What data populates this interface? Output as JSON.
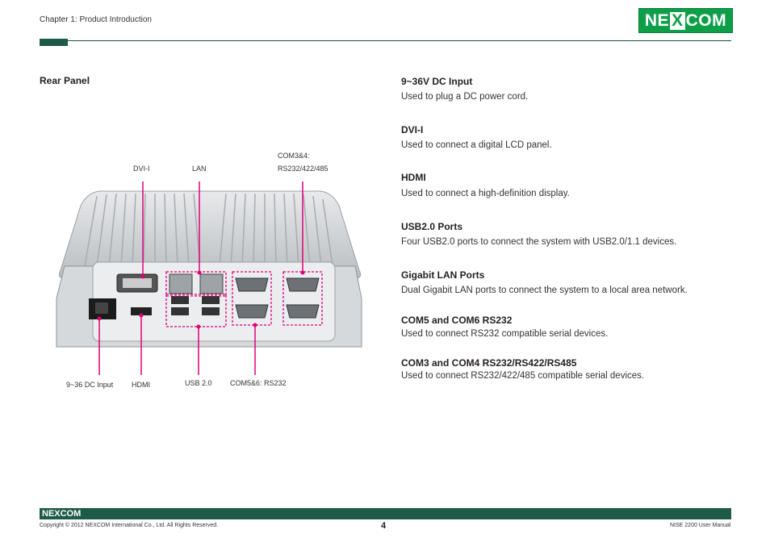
{
  "header": {
    "chapter": "Chapter 1: Product Introduction",
    "logo_text_left": "NE",
    "logo_text_x": "X",
    "logo_text_right": "COM"
  },
  "section_title": "Rear Panel",
  "callouts": {
    "dvi": "DVI-I",
    "lan": "LAN",
    "com34_line1": "COM3&4:",
    "com34_line2": "RS232/422/485",
    "dc": "9~36 DC Input",
    "hdmi": "HDMI",
    "usb": "USB 2.0",
    "com56": "COM5&6: RS232"
  },
  "items": [
    {
      "title": "9~36V DC Input",
      "desc": "Used to plug a DC power cord."
    },
    {
      "title": "DVI-I",
      "desc": "Used to connect a digital LCD panel."
    },
    {
      "title": "HDMI",
      "desc": "Used to connect a high-definition display."
    },
    {
      "title": "USB2.0 Ports",
      "desc": "Four USB2.0 ports to connect the system with USB2.0/1.1 devices."
    },
    {
      "title": "Gigabit LAN Ports",
      "desc": "Dual Gigabit LAN ports to connect the system to a local area network."
    },
    {
      "title": "COM5 and COM6 RS232",
      "desc": "Used to connect RS232 compatible serial devices."
    },
    {
      "title": "COM3 and COM4 RS232/RS422/RS485",
      "desc": "Used to connect RS232/422/485 compatible serial devices."
    }
  ],
  "footer": {
    "logo": "NEXCOM",
    "copyright": "Copyright © 2012 NEXCOM International Co., Ltd. All Rights Reserved.",
    "page": "4",
    "manual": "NISE 2200 User Manual"
  },
  "colors": {
    "brand_green": "#0c9f48",
    "bar_green": "#1e5a48",
    "callout_magenta": "#e0007a"
  }
}
